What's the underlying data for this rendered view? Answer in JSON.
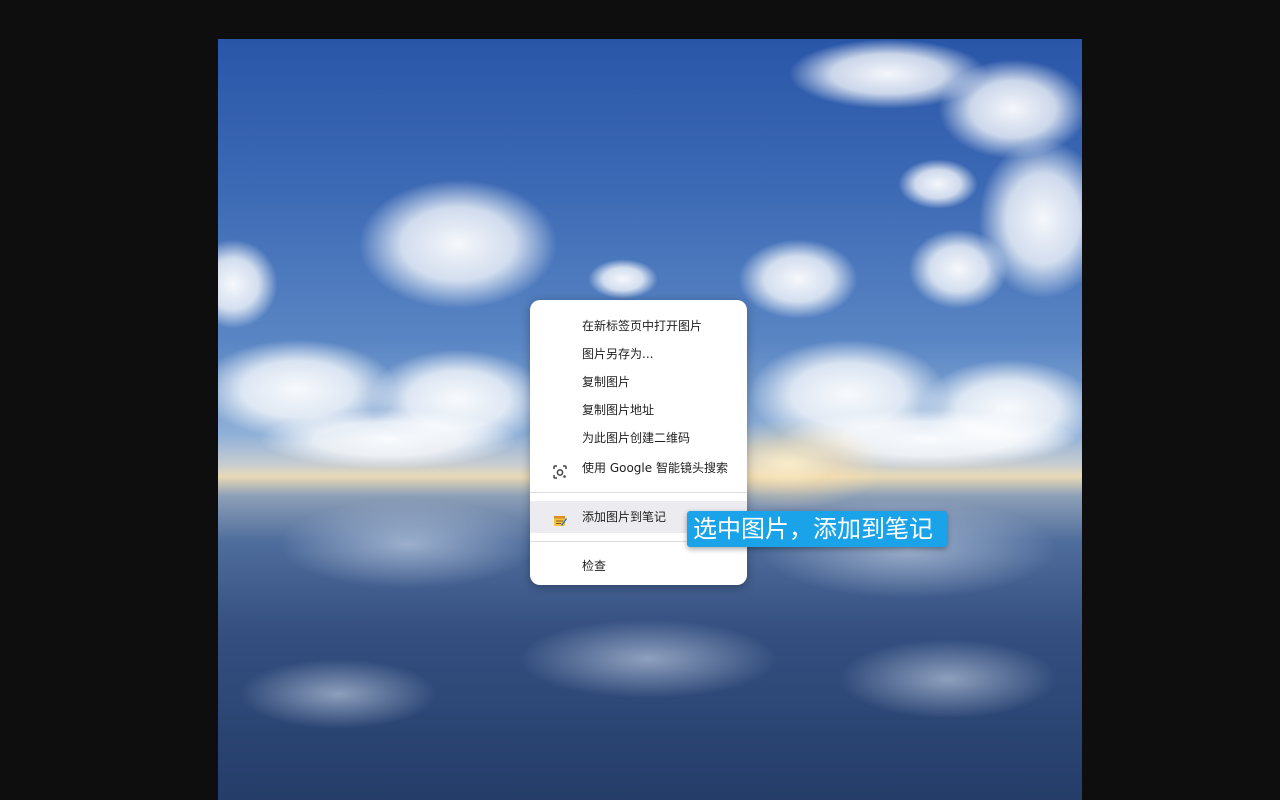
{
  "context_menu": {
    "items": [
      {
        "label": "在新标签页中打开图片"
      },
      {
        "label": "图片另存为..."
      },
      {
        "label": "复制图片"
      },
      {
        "label": "复制图片地址"
      },
      {
        "label": "为此图片创建二维码"
      },
      {
        "label": "使用 Google 智能镜头搜索",
        "icon": "google-lens-icon"
      },
      {
        "label": "添加图片到笔记",
        "icon": "notes-icon"
      },
      {
        "label": "检查"
      }
    ]
  },
  "callout": {
    "text": "选中图片，添加到笔记",
    "color": "#1aa3e8"
  },
  "colors": {
    "menu_background": "#ffffff",
    "hover_background": "#ececf0",
    "page_background": "#0e0e0e"
  }
}
